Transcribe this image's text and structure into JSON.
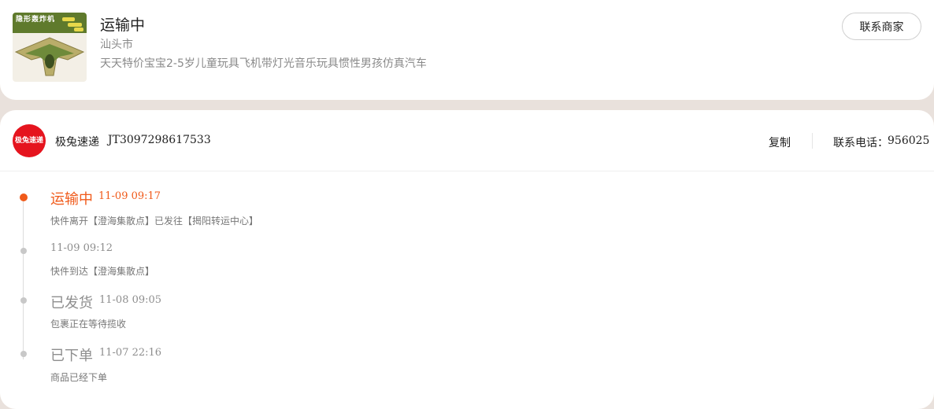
{
  "order": {
    "status": "运输中",
    "city": "汕头市",
    "product_title": "天天特价宝宝2-5岁儿童玩具飞机带灯光音乐玩具惯性男孩仿真汽车",
    "thumbnail_banner_text": "隐形轰炸机",
    "contact_merchant_label": "联系商家"
  },
  "logistics": {
    "carrier_logo_text": "极兔速递",
    "carrier_name": "极兔速递",
    "tracking_number": "JT3097298617533",
    "copy_label": "复制",
    "phone_label": "联系电话：",
    "phone_number": "956025"
  },
  "timeline": [
    {
      "status": "运输中",
      "time": "11-09 09:17",
      "desc": "快件离开【澄海集散点】已发往【揭阳转运中心】"
    },
    {
      "status": "",
      "time": "11-09 09:12",
      "desc": "快件到达【澄海集散点】"
    },
    {
      "status": "已发货",
      "time": "11-08 09:05",
      "desc": "包裹正在等待揽收"
    },
    {
      "status": "已下单",
      "time": "11-07 22:16",
      "desc": "商品已经下单"
    }
  ],
  "colors": {
    "accent": "#f05a1a",
    "carrier_red": "#e5141e",
    "page_bg": "#e9e1dc"
  }
}
